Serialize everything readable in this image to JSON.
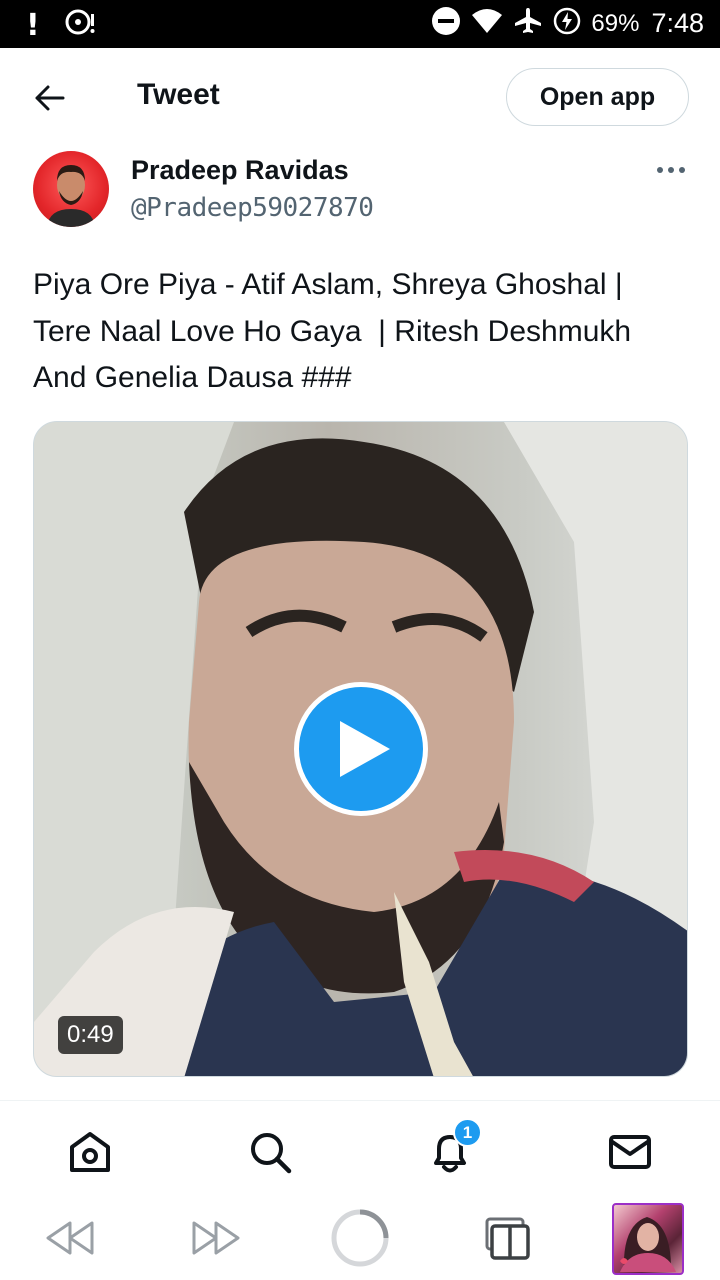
{
  "status_bar": {
    "notification_excl": "!",
    "battery_percent": "69%",
    "time": "7:48",
    "icons": [
      "media-icon",
      "dnd-icon",
      "wifi-icon",
      "airplane-icon",
      "battery-charging-icon"
    ]
  },
  "header": {
    "title": "Tweet",
    "open_app_label": "Open app"
  },
  "author": {
    "name": "Pradeep Ravidas",
    "handle": "@Pradeep59027870"
  },
  "tweet": {
    "text": "Piya Ore Piya - Atif Aslam, Shreya Ghoshal |\nTere Naal Love Ho Gaya  | Ritesh Deshmukh\nAnd Genelia Dausa ###"
  },
  "media": {
    "type": "video",
    "duration": "0:49"
  },
  "bottom_nav": {
    "items": [
      "home-icon",
      "search-icon",
      "notifications-icon",
      "messages-icon"
    ],
    "notification_badge": "1"
  },
  "browser_bar": {
    "items": [
      "rewind-icon",
      "fast-forward-icon",
      "loading-icon",
      "tabs-icon",
      "tab-thumbnail"
    ]
  },
  "colors": {
    "accent": "#1d9bf0",
    "text_primary": "#0f1419",
    "text_secondary": "#536471",
    "border": "#cfd9de",
    "thumbnail_border": "#9b2fc7"
  }
}
